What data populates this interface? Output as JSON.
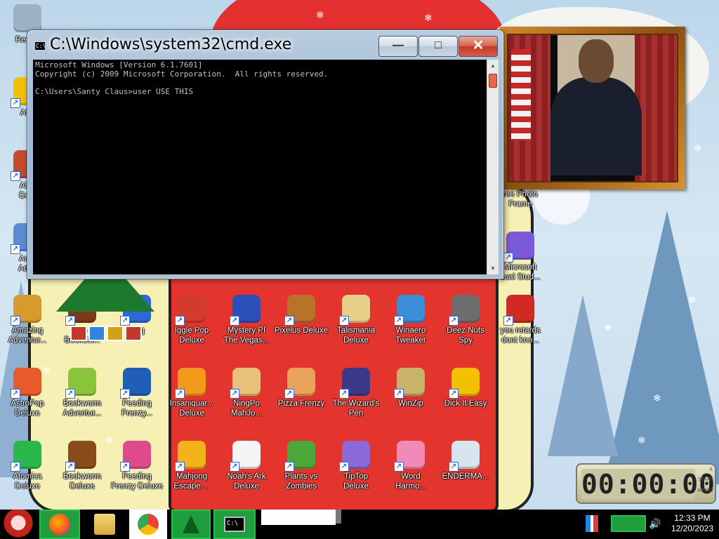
{
  "wallpaper": {
    "theme": "christmas",
    "colors": {
      "sky": "#c7dcee",
      "hat": "#e53030",
      "shirt": "#e3342e",
      "face": "#f6f0b5"
    }
  },
  "desktop_icons": [
    {
      "id": "recycle-bin",
      "label": "Recycl",
      "icon": "recycle-bin-icon",
      "color": "#9db2c4",
      "shortcut": false
    },
    {
      "id": "aim",
      "label": "AIM",
      "icon": "aim-runner-icon",
      "color": "#f2c200",
      "shortcut": true
    },
    {
      "id": "alchemy",
      "label": "Alch\nDelu",
      "icon": "alchemy-icon",
      "color": "#c34a2c",
      "shortcut": true
    },
    {
      "id": "amazing-adventures",
      "label": "Ama\nAdve",
      "icon": "diamond-icon",
      "color": "#5b8ad6",
      "shortcut": true
    },
    {
      "id": "amazing-adventures-2",
      "label": "Amazing\nAdventur...",
      "icon": "compass-icon",
      "color": "#d79a2c",
      "shortcut": true
    },
    {
      "id": "bookworm-bookstore",
      "label": "Bo\nBooksto...",
      "icon": "book-icon",
      "color": "#7b3a1a",
      "shortcut": true
    },
    {
      "id": "fishing",
      "label": "hing",
      "icon": "fish-icon",
      "color": "#2b6ad6",
      "shortcut": true
    },
    {
      "id": "iggle-pop",
      "label": "Iggle Pop\nDeluxe",
      "icon": "iggle-icon",
      "color": "#d33b2c",
      "shortcut": true
    },
    {
      "id": "mystery-pi",
      "label": "Mystery PI\nThe Vegas...",
      "icon": "mpi-icon",
      "color": "#2a50b8",
      "shortcut": true
    },
    {
      "id": "pixelus",
      "label": "Pixelus Deluxe",
      "icon": "adventurer-icon",
      "color": "#b8722a",
      "shortcut": true
    },
    {
      "id": "talismania",
      "label": "Talismania\nDeluxe",
      "icon": "king-icon",
      "color": "#e7d08a",
      "shortcut": true
    },
    {
      "id": "winaero-tweaker",
      "label": "Winaero\nTweaker",
      "icon": "winaero-icon",
      "color": "#3a8ed6",
      "shortcut": true
    },
    {
      "id": "deez-nuts-spy",
      "label": "Deez Nuts\nSpy",
      "icon": "window-stack-icon",
      "color": "#6d6d6d",
      "shortcut": true
    },
    {
      "id": "you-retards",
      "label": "you retards\ndont kno...",
      "icon": "dragon-icon",
      "color": "#d02a22",
      "shortcut": true
    },
    {
      "id": "astropop",
      "label": "AstroPop\nDeluxe",
      "icon": "astropop-icon",
      "color": "#e85a2a",
      "shortcut": true
    },
    {
      "id": "bookworm-adventures",
      "label": "Bookworm\nAdventur...",
      "icon": "worm-icon",
      "color": "#8ac43a",
      "shortcut": true
    },
    {
      "id": "feeding-frenzy-2",
      "label": "Feeding\nFrenzy...",
      "icon": "fish-icon",
      "color": "#1f5fb8",
      "shortcut": true
    },
    {
      "id": "insaniquarium",
      "label": "Insaniquar...\nDeluxe",
      "icon": "goldfish-icon",
      "color": "#f29a1a",
      "shortcut": true
    },
    {
      "id": "ningpo",
      "label": "NingPo\nMahJo...",
      "icon": "mahjong-tile-icon",
      "color": "#e8c27a",
      "shortcut": true
    },
    {
      "id": "pizza-frenzy",
      "label": "Pizza Frenzy",
      "icon": "pizza-icon",
      "color": "#e8a25a",
      "shortcut": true
    },
    {
      "id": "wizards-pen",
      "label": "The Wizard's\nPen",
      "icon": "wizard-icon",
      "color": "#3a3a8a",
      "shortcut": true
    },
    {
      "id": "winzip",
      "label": "WinZip",
      "icon": "cabinet-icon",
      "color": "#c9b26a",
      "shortcut": true
    },
    {
      "id": "dick-it-easy",
      "label": "Dick It Easy",
      "icon": "de-logo-icon",
      "color": "#f2c200",
      "shortcut": true
    },
    {
      "id": "atomica",
      "label": "Atomica\nDeluxe",
      "icon": "radiation-icon",
      "color": "#2ab84a",
      "shortcut": true
    },
    {
      "id": "bookworm-deluxe",
      "label": "Bookworm\nDeluxe",
      "icon": "book-icon",
      "color": "#8a4a1a",
      "shortcut": true
    },
    {
      "id": "feeding-frenzy",
      "label": "Feeding\nFrenzy Deluxe",
      "icon": "fish-icon",
      "color": "#e04a8a",
      "shortcut": true
    },
    {
      "id": "mahjong-escape",
      "label": "Mahjong\nEscape ...",
      "icon": "mahjong-tile-icon",
      "color": "#f2b41a",
      "shortcut": true
    },
    {
      "id": "noahs-ark",
      "label": "Noah's Ark\nDeluxe",
      "icon": "dove-icon",
      "color": "#f4f4f4",
      "shortcut": true
    },
    {
      "id": "plants-vs-zombies",
      "label": "Plants vs\nZombies",
      "icon": "flower-icon",
      "color": "#4aa83a",
      "shortcut": true
    },
    {
      "id": "tiptop",
      "label": "TipTop\nDeluxe",
      "icon": "cocktail-icon",
      "color": "#8a6ad8",
      "shortcut": true
    },
    {
      "id": "word-harmony",
      "label": "Word\nHarmo...",
      "icon": "blossom-icon",
      "color": "#f28ab8",
      "shortcut": true
    },
    {
      "id": "enderma",
      "label": "ENDERMA...",
      "icon": "window-icon",
      "color": "#d8e4ee",
      "shortcut": true
    },
    {
      "id": "photo-frame-label",
      "label": "ree Photo\nFrame",
      "icon": "photo-frame-icon",
      "color": "#8a4f12",
      "shortcut": false
    },
    {
      "id": "visual-studio",
      "label": "Microsoft\nsual Stud...",
      "icon": "infinity-icon",
      "color": "#7a5ad8",
      "shortcut": true
    }
  ],
  "cmd": {
    "title": "C:\\Windows\\system32\\cmd.exe",
    "minimize_label": "—",
    "maximize_label": "□",
    "close_label": "✕",
    "console_text": "Microsoft Windows [Version 6.1.7601]\nCopyright (c) 2009 Microsoft Corporation.  All rights reserved.\n\nC:\\Users\\Santy Claus>user USE THIS",
    "icon_text": "C:\\"
  },
  "photo_frame": {
    "subject": "portrait-photo"
  },
  "stopwatch": {
    "time": "00:00:00",
    "start_label": "START",
    "reset_label": "RESET",
    "close_label": "x"
  },
  "taskbar": {
    "items": [
      {
        "id": "firefox",
        "icon": "firefox-icon",
        "active": true
      },
      {
        "id": "explorer",
        "icon": "folder-icon",
        "active": false
      },
      {
        "id": "chrome",
        "icon": "chrome-icon",
        "active": false
      },
      {
        "id": "christmas-tree",
        "icon": "christmas-tree-icon",
        "active": true
      },
      {
        "id": "cmd",
        "icon": "cmd-icon",
        "active": true
      }
    ],
    "tray": {
      "time": "12:33 PM",
      "date": "12/20/2023"
    }
  }
}
